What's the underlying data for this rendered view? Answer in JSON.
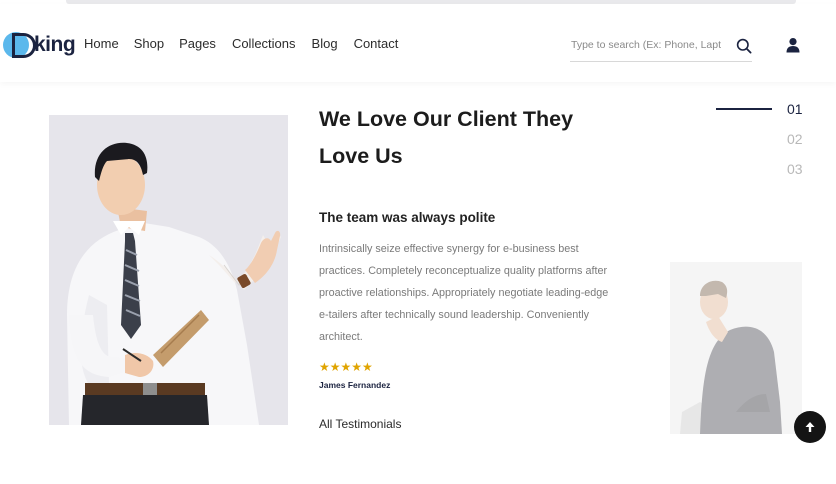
{
  "header": {
    "logo_text": "king",
    "nav": [
      "Home",
      "Shop",
      "Pages",
      "Collections",
      "Blog",
      "Contact"
    ],
    "search_placeholder": "Type to search (Ex: Phone, Laptop)",
    "icons": {
      "search": "search-icon",
      "account": "user-icon"
    }
  },
  "testimonial": {
    "title_line1": "We Love Our Client They",
    "title_line2": "Love Us",
    "heading": "The team was always polite",
    "body": "Intrinsically seize effective synergy for e-business best practices. Completely reconceptualize quality platforms after proactive relationships. Appropriately negotiate leading-edge e-tailers after technically sound leadership. Conveniently architect.",
    "stars": "★★★★★",
    "author": "James Fernandez",
    "all_link": "All Testimonials"
  },
  "pager": [
    "01",
    "02",
    "03"
  ],
  "colors": {
    "accent": "#1b2340",
    "star": "#e0a400",
    "logo_circle": "#5bb8ec"
  }
}
